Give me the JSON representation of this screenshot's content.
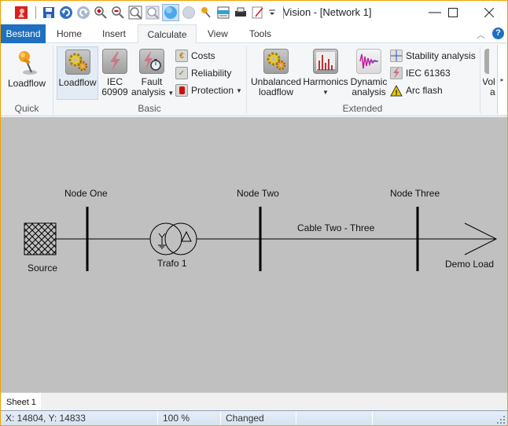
{
  "window": {
    "title": "Vision - [Network 1]",
    "controls": {
      "minimize": "—",
      "maximize": "☐",
      "close": "✕"
    }
  },
  "quick_access": [
    {
      "name": "app-logo-icon"
    },
    {
      "name": "save-icon"
    },
    {
      "name": "undo-icon"
    },
    {
      "name": "redo-icon"
    },
    {
      "name": "zoom-in-icon"
    },
    {
      "name": "zoom-out-icon"
    },
    {
      "name": "zoom-fit-icon"
    },
    {
      "name": "zoom-window-icon"
    },
    {
      "name": "select-mode-icon"
    },
    {
      "name": "circle-mode-icon"
    },
    {
      "name": "loadflow-pin-icon"
    },
    {
      "name": "report-icon"
    },
    {
      "name": "print-icon"
    },
    {
      "name": "edit-icon"
    },
    {
      "name": "customize-dropdown-icon"
    }
  ],
  "ribbon": {
    "tabs": [
      {
        "label": "Bestand",
        "type": "file"
      },
      {
        "label": "Home"
      },
      {
        "label": "Insert"
      },
      {
        "label": "Calculate",
        "active": true
      },
      {
        "label": "View"
      },
      {
        "label": "Tools"
      }
    ],
    "help_label": "?",
    "groups": {
      "quick": {
        "label": "Quick",
        "loadflow": "Loadflow"
      },
      "basic": {
        "label": "Basic",
        "loadflow": "Loadflow",
        "iec60909_line1": "IEC",
        "iec60909_line2": "60909",
        "fault_line1": "Fault",
        "fault_line2": "analysis",
        "costs": "Costs",
        "reliability": "Reliability",
        "protection": "Protection"
      },
      "extended": {
        "label": "Extended",
        "unbalanced_line1": "Unbalanced",
        "unbalanced_line2": "loadflow",
        "harmonics": "Harmonics",
        "dynamic_line1": "Dynamic",
        "dynamic_line2": "analysis",
        "stability": "Stability analysis",
        "iec61363": "IEC 61363",
        "arcflash": "Arc flash"
      },
      "overflow": {
        "line1": "Vol",
        "line2": "a"
      }
    }
  },
  "diagram": {
    "nodes": [
      {
        "label": "Node One"
      },
      {
        "label": "Node Two"
      },
      {
        "label": "Node Three"
      }
    ],
    "source": {
      "label": "Source"
    },
    "transformer": {
      "label": "Trafo 1",
      "primary": "Y",
      "secondary": "Δ"
    },
    "cable": {
      "label": "Cable Two - Three"
    },
    "load": {
      "label": "Demo Load"
    },
    "colors": {
      "background": "#c0c0c0",
      "line": "#000000"
    }
  },
  "sheets": [
    {
      "label": "Sheet 1",
      "active": true
    }
  ],
  "status": {
    "coords": "X: 14804, Y: 14833",
    "zoom": "100 %",
    "state": "Changed"
  }
}
